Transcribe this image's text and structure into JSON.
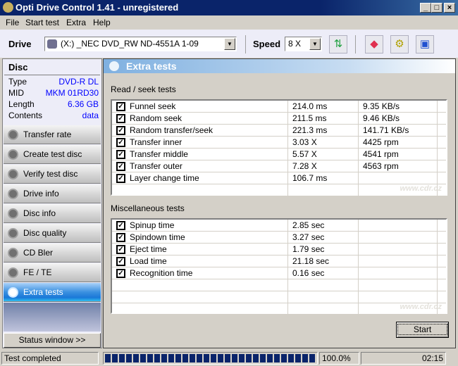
{
  "window": {
    "title": "Opti Drive Control 1.41 - unregistered"
  },
  "menu": [
    "File",
    "Start test",
    "Extra",
    "Help"
  ],
  "toolbar": {
    "drive_label": "Drive",
    "drive_value": "(X:)  _NEC DVD_RW ND-4551A 1-09",
    "speed_label": "Speed",
    "speed_value": "8 X"
  },
  "disc": {
    "header": "Disc",
    "rows": [
      {
        "k": "Type",
        "v": "DVD-R DL"
      },
      {
        "k": "MID",
        "v": "MKM 01RD30"
      },
      {
        "k": "Length",
        "v": "6.36 GB"
      },
      {
        "k": "Contents",
        "v": "data"
      }
    ]
  },
  "nav": [
    "Transfer rate",
    "Create test disc",
    "Verify test disc",
    "Drive info",
    "Disc info",
    "Disc quality",
    "CD Bler",
    "FE / TE",
    "Extra tests"
  ],
  "nav_active": "Extra tests",
  "status_window_label": "Status window >>",
  "main": {
    "title": "Extra tests",
    "read_seek_label": "Read / seek tests",
    "read_seek": [
      {
        "name": "Funnel seek",
        "v1": "214.0 ms",
        "v2": "9.35 KB/s",
        "checked": true
      },
      {
        "name": "Random seek",
        "v1": "211.5 ms",
        "v2": "9.46 KB/s",
        "checked": true
      },
      {
        "name": "Random transfer/seek",
        "v1": "221.3 ms",
        "v2": "141.71 KB/s",
        "checked": true
      },
      {
        "name": "Transfer inner",
        "v1": "3.03 X",
        "v2": "4425 rpm",
        "checked": true
      },
      {
        "name": "Transfer middle",
        "v1": "5.57 X",
        "v2": "4541 rpm",
        "checked": true
      },
      {
        "name": "Transfer outer",
        "v1": "7.28 X",
        "v2": "4563 rpm",
        "checked": true
      },
      {
        "name": "Layer change time",
        "v1": "106.7 ms",
        "v2": "",
        "checked": true
      }
    ],
    "misc_label": "Miscellaneous tests",
    "misc": [
      {
        "name": "Spinup time",
        "v1": "2.85 sec",
        "checked": true
      },
      {
        "name": "Spindown time",
        "v1": "3.27 sec",
        "checked": true
      },
      {
        "name": "Eject time",
        "v1": "1.79 sec",
        "checked": true
      },
      {
        "name": "Load time",
        "v1": "21.18 sec",
        "checked": true
      },
      {
        "name": "Recognition time",
        "v1": "0.16 sec",
        "checked": true
      }
    ],
    "start_label": "Start",
    "watermark": "cdr.cz"
  },
  "statusbar": {
    "text": "Test completed",
    "progress_percent": 100,
    "progress_label": "100.0%",
    "time": "02:15"
  },
  "colors": {
    "titlebar": "#0a246a",
    "progress": "#0a246a",
    "accent": "#1a78d8"
  }
}
